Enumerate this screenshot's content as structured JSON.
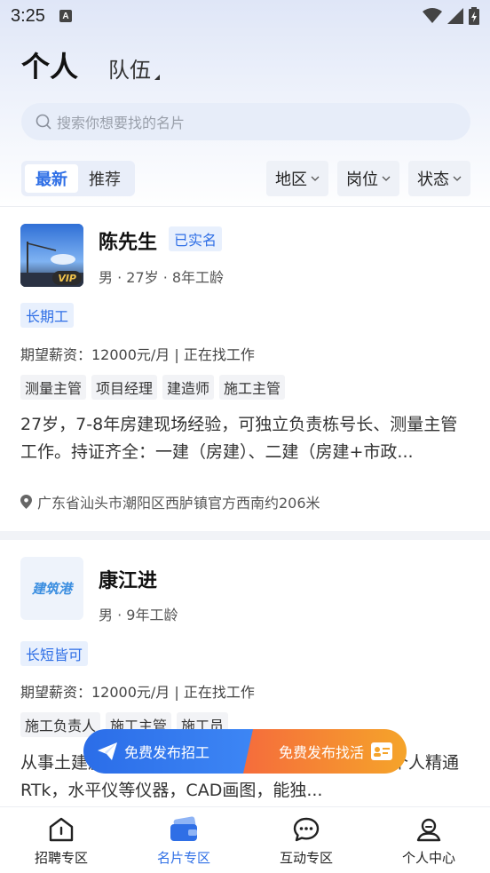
{
  "status_bar": {
    "time": "3:25",
    "a_badge": "A"
  },
  "header": {
    "title": "个人",
    "team_tab": "队伍"
  },
  "search": {
    "placeholder": "搜索你想要找的名片"
  },
  "filters": {
    "segments": [
      {
        "label": "最新",
        "active": true
      },
      {
        "label": "推荐",
        "active": false
      }
    ],
    "dropdowns": [
      {
        "label": "地区"
      },
      {
        "label": "岗位"
      },
      {
        "label": "状态"
      }
    ]
  },
  "cards": [
    {
      "name": "陈先生",
      "verified": "已实名",
      "avatar_badge": "VIP",
      "meta": "男 · 27岁 · 8年工龄",
      "tag": "长期工",
      "salary": "期望薪资：12000元/月 | 正在找工作",
      "skills": [
        "测量主管",
        "项目经理",
        "建造师",
        "施工主管"
      ],
      "description": "27岁，7-8年房建现场经验，可独立负责栋号长、测量主管工作。持证齐全：一建（房建）、二建（房建+市政...",
      "location": "广东省汕头市潮阳区西胪镇官方西南约206米"
    },
    {
      "name": "康江进",
      "avatar_text": "建筑港",
      "meta": "男 · 9年工龄",
      "tag": "长短皆可",
      "salary": "期望薪资：12000元/月 | 正在找工作",
      "skills": [
        "施工负责人",
        "施工主管",
        "施工员"
      ],
      "description": "从事土建施工管理多年，熟悉各类工程项目施工，个人精通RTk，水平仪等仪器，CAD画图，能独..."
    }
  ],
  "float_actions": {
    "post_job": "免费发布招工",
    "post_find": "免费发布找活"
  },
  "bottom_nav": [
    {
      "label": "招聘专区",
      "icon": "house-icon",
      "active": false
    },
    {
      "label": "名片专区",
      "icon": "wallet-card-icon",
      "active": true
    },
    {
      "label": "互动专区",
      "icon": "chat-bubble-icon",
      "active": false
    },
    {
      "label": "个人中心",
      "icon": "user-icon",
      "active": false
    }
  ],
  "colors": {
    "accent": "#2f6fe6",
    "orange": "#f5a42a",
    "tag_bg": "#e8f0fd"
  }
}
